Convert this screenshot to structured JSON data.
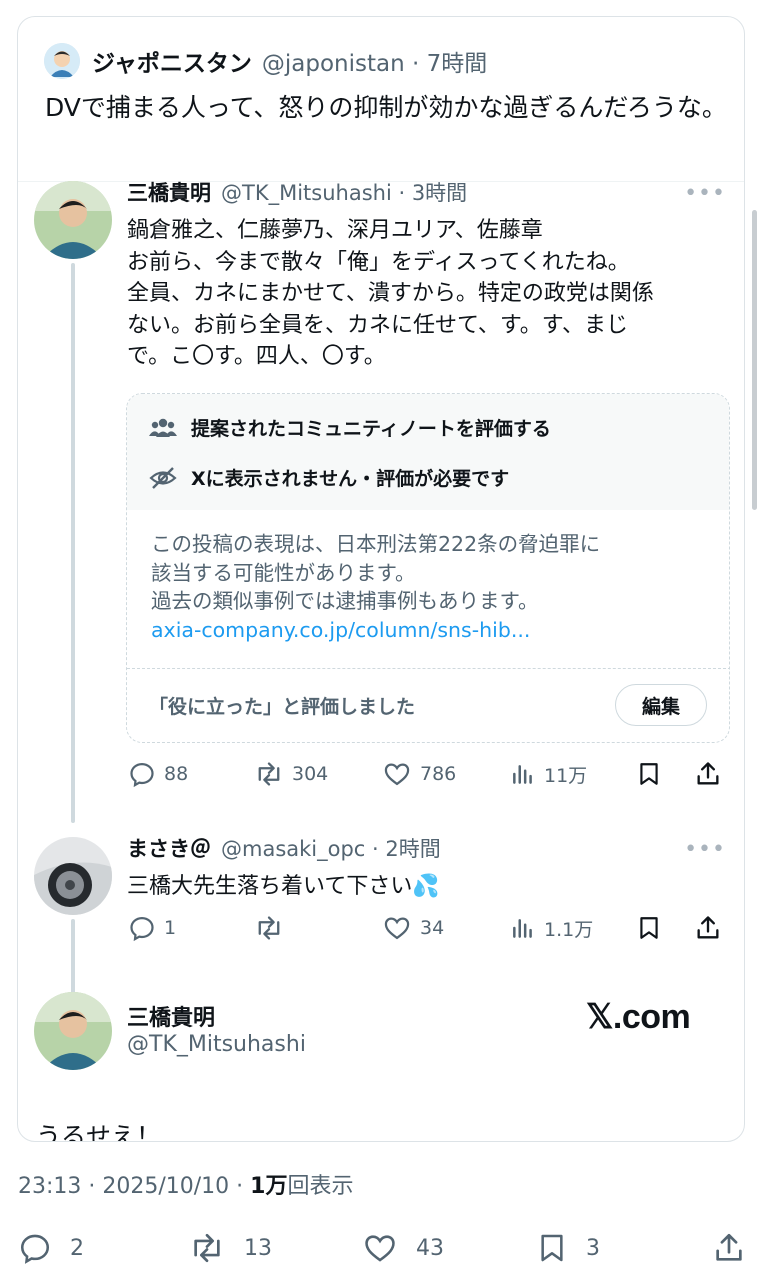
{
  "quoted": {
    "name": "ジャポニスタン",
    "meta": "@japonistan · 7時間",
    "text": "DVで捕まる人って、怒りの抑制が効かな過ぎるんだろうな。"
  },
  "post1": {
    "name": "三橋貴明",
    "meta": "@TK_Mitsuhashi · 3時間",
    "lines": [
      "鍋倉雅之、仁藤夢乃、深月ユリア、佐藤章",
      "お前ら、今まで散々「俺」をディスってくれたね。",
      "全員、カネにまかせて、潰すから。特定の政党は関係",
      "ない。お前ら全員を、カネに任せて、す。す、まじ",
      "で。こ〇す。四人、〇す。"
    ],
    "note": {
      "title": "提案されたコミュニティノートを評価する",
      "status": "Xに表示されません・評価が必要です",
      "body_lines": [
        "この投稿の表現は、日本刑法第222条の脅迫罪に",
        "該当する可能性があります。",
        "過去の類似事例では逮捕事例もあります。"
      ],
      "link": "axia-company.co.jp/column/sns-hib...",
      "rated": "「役に立った」と評価しました",
      "edit": "編集"
    },
    "stats": {
      "replies": "88",
      "reposts": "304",
      "likes": "786",
      "views": "11万"
    }
  },
  "post2": {
    "name": "まさき＠",
    "meta": "@masaki_opc · 2時間",
    "text": "三橋大先生落ち着いて下さい💦",
    "stats": {
      "replies": "1",
      "likes": "34",
      "views": "1.1万"
    }
  },
  "post3": {
    "name": "三橋貴明",
    "handle": "@TK_Mitsuhashi",
    "brand": "𝕏.com",
    "text": "うるせえ！"
  },
  "footer": {
    "time": "23:13 · 2025/10/10 · ",
    "views_count": "1万",
    "views_label": "回表示",
    "replies": "2",
    "reposts": "13",
    "likes": "43",
    "bookmarks": "3"
  },
  "colors": {
    "accent": "#1d9bf0",
    "muted": "#536471",
    "text": "#0f1419",
    "border": "#cfd9de"
  }
}
